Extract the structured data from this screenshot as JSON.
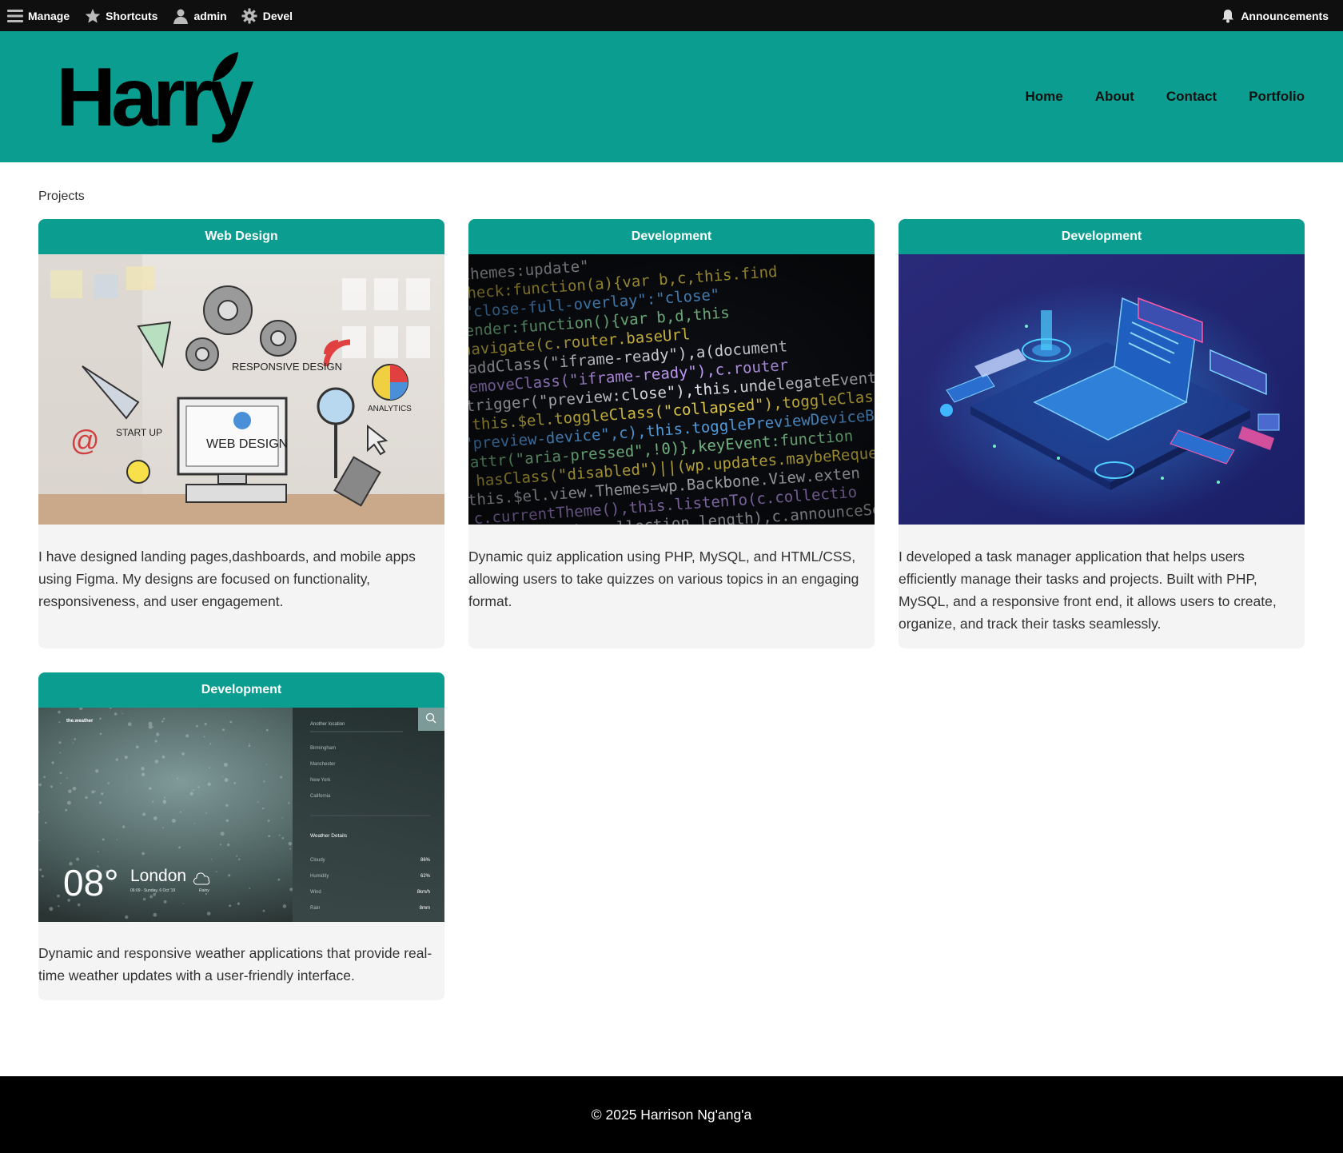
{
  "toolbar": {
    "manage": "Manage",
    "shortcuts": "Shortcuts",
    "user": "admin",
    "devel": "Devel",
    "announcements": "Announcements"
  },
  "header": {
    "logo_text": "Harry",
    "nav": [
      "Home",
      "About",
      "Contact",
      "Portfolio"
    ]
  },
  "page": {
    "title": "Projects"
  },
  "projects": [
    {
      "category": "Web Design",
      "image_labels": [
        "RESPONSIVE DESIGN",
        "WEB DESIGN",
        "START UP",
        "ANALYTICS"
      ],
      "description": "I have designed landing pages,dashboards, and mobile apps using Figma. My designs are focused on functionality, responsiveness, and user engagement."
    },
    {
      "category": "Development",
      "image_code": [
        "\"themes:update\"",
        "Check:function(a){var b,c,this.find",
        "\"close-full-overlay\":\"close\"",
        "render:function(){var b,d,this",
        "navigate(c.router.baseUrl",
        "addClass(\"iframe-ready\"),a(document",
        "removeClass(\"iframe-ready\"),c.router",
        "trigger(\"preview:close\"),this.undelegateEvents",
        "this.$el.toggleClass(\"collapsed\"),toggleClass",
        "\"preview-device\",c),this.togglePreviewDeviceButton",
        "attr(\"aria-pressed\",!0)},keyEvent:function",
        "hasClass(\"disabled\")||(wp.updates.maybeRequestFi",
        "this.$el.view.Themes=wp.Backbone.View.exten",
        "c.currentTheme(),this.listenTo(c.collectio",
        "count.text(c.collection.length),c.announceSear"
      ],
      "description": "Dynamic quiz application using PHP, MySQL, and HTML/CSS, allowing users to take quizzes on various topics in an engaging format."
    },
    {
      "category": "Development",
      "description": "I developed a task manager application that helps users efficiently manage their tasks and projects. Built with PHP, MySQL, and a responsive front end, it allows users to create, organize, and track their tasks seamlessly."
    },
    {
      "category": "Development",
      "weather": {
        "brand": "the.weather",
        "search_placeholder": "Another location",
        "locations": [
          "Birmingham",
          "Manchester",
          "New York",
          "California"
        ],
        "details_title": "Weather Details",
        "details": [
          {
            "label": "Cloudy",
            "value": "86%"
          },
          {
            "label": "Humidity",
            "value": "62%"
          },
          {
            "label": "Wind",
            "value": "8km/h"
          },
          {
            "label": "Rain",
            "value": "8mm"
          }
        ],
        "temp": "08°",
        "city": "London",
        "date": "06:09 - Sunday, 6 Oct '19",
        "condition": "Rainy"
      },
      "description": "Dynamic and responsive weather applications that provide real-time weather updates with a user-friendly interface."
    }
  ],
  "footer": {
    "text": "© 2025 Harrison Ng'ang'a"
  },
  "colors": {
    "brand": "#0b9e90",
    "toolbar": "#0f0f0f",
    "footer": "#000000",
    "card_bg": "#f4f4f4"
  }
}
